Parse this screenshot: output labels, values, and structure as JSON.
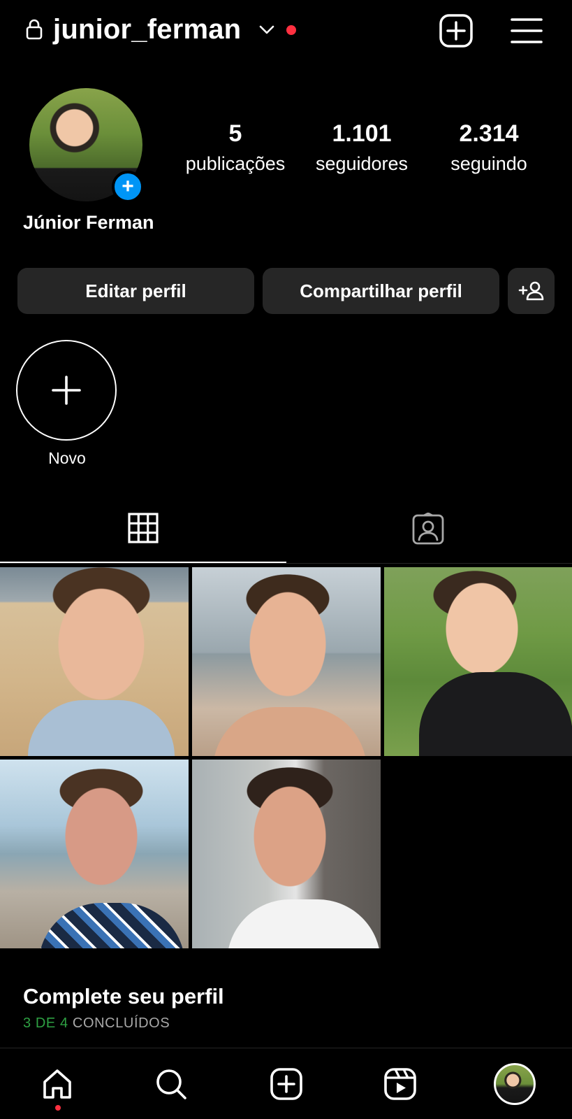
{
  "header": {
    "username": "junior_ferman",
    "lock_icon": "lock-icon",
    "chevron_icon": "chevron-down-icon",
    "notification_color": "#ff3040",
    "create_icon": "plus-square-icon",
    "menu_icon": "hamburger-menu-icon"
  },
  "profile": {
    "display_name": "Júnior Ferman",
    "add_story_badge": "+",
    "badge_color": "#0095f6",
    "stats": {
      "posts": {
        "value": "5",
        "label": "publicações"
      },
      "followers": {
        "value": "1.101",
        "label": "seguidores"
      },
      "following": {
        "value": "2.314",
        "label": "seguindo"
      }
    }
  },
  "buttons": {
    "edit": "Editar perfil",
    "share": "Compartilhar perfil",
    "add_person_icon": "add-person-icon"
  },
  "highlights": {
    "new_label": "Novo",
    "new_icon": "plus-icon"
  },
  "tabs": [
    {
      "name": "grid",
      "icon": "grid-icon",
      "active": true
    },
    {
      "name": "tagged",
      "icon": "tagged-user-icon",
      "active": false
    }
  ],
  "posts": [
    {
      "id": "post-1"
    },
    {
      "id": "post-2"
    },
    {
      "id": "post-3"
    },
    {
      "id": "post-4"
    },
    {
      "id": "post-5"
    }
  ],
  "complete_profile": {
    "title": "Complete seu perfil",
    "progress_count": "3 DE 4",
    "progress_text": "CONCLUÍDOS",
    "progress_color": "#2ea043"
  },
  "bottom_nav": [
    {
      "name": "home",
      "icon": "home-icon",
      "active": true
    },
    {
      "name": "search",
      "icon": "search-icon"
    },
    {
      "name": "create",
      "icon": "plus-square-icon"
    },
    {
      "name": "reels",
      "icon": "reels-icon"
    },
    {
      "name": "profile",
      "icon": "profile-avatar"
    }
  ]
}
